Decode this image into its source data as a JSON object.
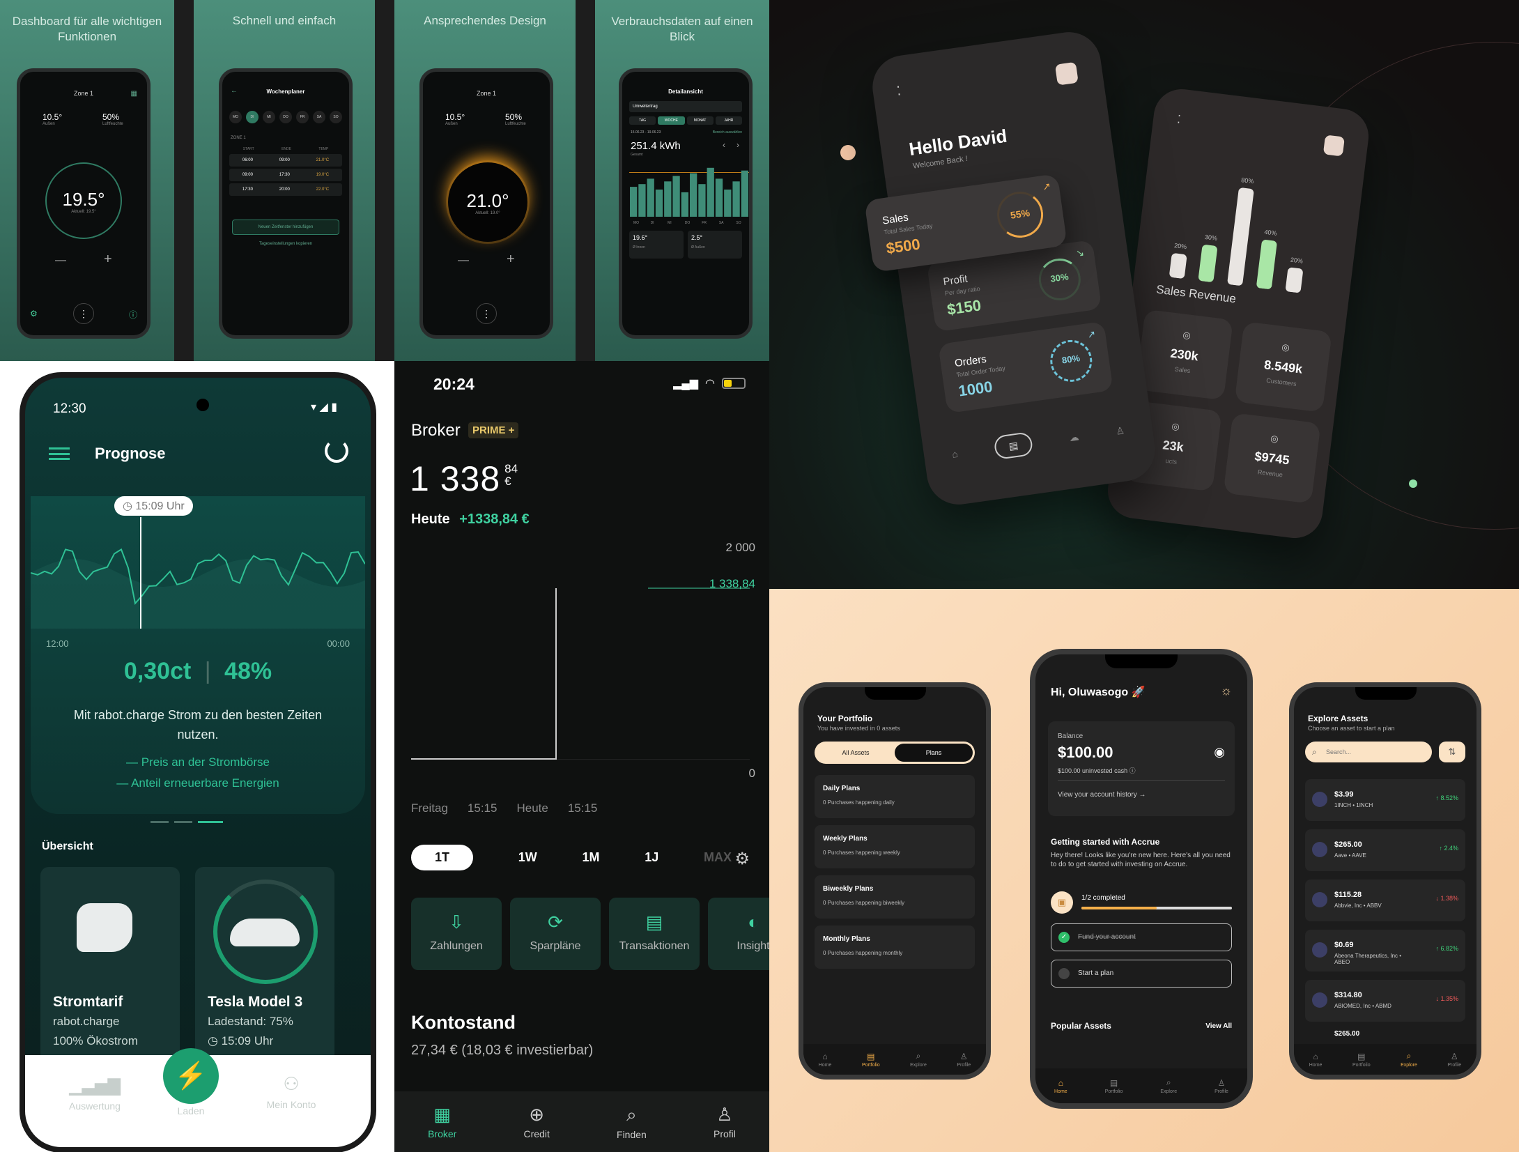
{
  "promo": {
    "captions": [
      "Dashboard für alle wichtigen Funktionen",
      "Schnell und einfach",
      "Ansprechendes Design",
      "Verbrauchsdaten auf einen Blick"
    ],
    "p1": {
      "zone": "Zone 1",
      "val1": "10.5°",
      "lab1": "Außen",
      "val2": "50%",
      "lab2": "Luftfeuchte",
      "big": "19.5°",
      "sub": "Aktuell: 19.5°",
      "minus": "—",
      "plus": "+"
    },
    "p2": {
      "title": "Wochenplaner",
      "days": [
        "MO",
        "DI",
        "MI",
        "DO",
        "FR",
        "SA",
        "SO"
      ],
      "zone": "ZONE 1",
      "cols": [
        "START",
        "ENDE",
        "TEMP"
      ],
      "rows": [
        [
          "06:00",
          "09:00",
          "21.0°C"
        ],
        [
          "09:00",
          "17:30",
          "19.0°C"
        ],
        [
          "17:30",
          "20:00",
          "22.0°C"
        ]
      ],
      "btn": "Neuen Zeitfenster hinzufügen",
      "link": "Tageseinstellungen kopieren"
    },
    "p3": {
      "zone": "Zone 1",
      "val1": "10.5°",
      "lab1": "Außen",
      "val2": "50%",
      "lab2": "Luftfeuchte",
      "big": "21.0°",
      "sub": "Aktuell: 19.0°"
    },
    "p4": {
      "title": "Detailansicht",
      "select": "Umweltertrag",
      "tabs": [
        "TAG",
        "WOCHE",
        "MONAT",
        "JAHR"
      ],
      "range": "15.06.23 - 19.06.23",
      "compare": "Bereich auswählen",
      "kwh": "251.4 kWh",
      "kwhsub": "Gesamt",
      "cards": [
        {
          "v": "19.6°",
          "l": "Ø Innen"
        },
        {
          "v": "2.5°",
          "l": "Ø Außen"
        }
      ],
      "bars": [
        0.55,
        0.6,
        0.7,
        0.5,
        0.65,
        0.75,
        0.45,
        0.8,
        0.6,
        0.9,
        0.7,
        0.5,
        0.65,
        0.85
      ],
      "xl": [
        "MO",
        "DI",
        "MI",
        "DO",
        "FR",
        "SA",
        "SO"
      ]
    }
  },
  "dash": {
    "greeting": "Hello David",
    "welcome": "Welcome Back !",
    "sales": {
      "title": "Sales",
      "sub": "Total Sales Today",
      "value": "$500",
      "pct": "55%"
    },
    "profit": {
      "title": "Profit",
      "sub": "Per day ratio",
      "value": "$150",
      "pct": "30%"
    },
    "orders": {
      "title": "Orders",
      "sub": "Total Order Today",
      "value": "1000",
      "pct": "80%"
    },
    "revenue_title": "Sales Revenue",
    "chart_data": {
      "type": "bar",
      "values": [
        20,
        30,
        80,
        40,
        20
      ],
      "labels": [
        "20%",
        "30%",
        "80%",
        "40%",
        "20%"
      ]
    },
    "stats": [
      {
        "v": "230k",
        "l": "Sales"
      },
      {
        "v": "8.549k",
        "l": "Customers"
      },
      {
        "v": "23k",
        "l": "ucts"
      },
      {
        "v": "$9745",
        "l": "Revenue"
      }
    ]
  },
  "prognose": {
    "time": "12:30",
    "title": "Prognose",
    "tooltip": "15:09 Uhr",
    "x_start": "12:00",
    "x_end": "00:00",
    "price": "0,30ct",
    "sep": "|",
    "pct": "48%",
    "desc": "Mit rabot.charge Strom zu den besten Zeiten nutzen.",
    "legend1": "Preis an der Strombörse",
    "legend2": "Anteil erneuerbare Energien",
    "overview": "Übersicht",
    "card1": {
      "title": "Stromtarif",
      "l1": "rabot.charge",
      "l2": "100% Ökostrom"
    },
    "card2": {
      "title": "Tesla Model 3",
      "l1": "Ladestand: 75%",
      "l2": "15:09 Uhr"
    },
    "nav": [
      "Auswertung",
      "Laden",
      "Mein Konto"
    ]
  },
  "broker": {
    "time": "20:24",
    "title": "Broker",
    "badge": "PRIME +",
    "amount": "1 338",
    "cents": "84",
    "currency": "€",
    "today_label": "Heute",
    "today_value": "+1338,84 €",
    "y_top": "2 000",
    "y_val": "1 338,84",
    "y_zero": "0",
    "x_labels": [
      "Freitag",
      "15:15",
      "Heute",
      "15:15"
    ],
    "ranges": [
      "1T",
      "1W",
      "1M",
      "1J",
      "MAX"
    ],
    "actions": [
      "Zahlungen",
      "Sparpläne",
      "Transaktionen",
      "Insight"
    ],
    "kontostand": "Kontostand",
    "kontostand_value": "27,34 € (18,03 € investierbar)",
    "nav": [
      "Broker",
      "Credit",
      "Finden",
      "Profil"
    ]
  },
  "accrue": {
    "left": {
      "title": "Your Portfolio",
      "sub": "You have invested in 0 assets",
      "seg": [
        "All Assets",
        "Plans"
      ],
      "plans": [
        {
          "t": "Daily Plans",
          "s": "0 Purchases happening daily"
        },
        {
          "t": "Weekly Plans",
          "s": "0 Purchases happening weekly"
        },
        {
          "t": "Biweekly Plans",
          "s": "0 Purchases happening biweekly"
        },
        {
          "t": "Monthly Plans",
          "s": "0 Purchases happening monthly"
        }
      ]
    },
    "mid": {
      "hello": "Hi, Oluwasogo 🚀",
      "balance_label": "Balance",
      "balance": "$100.00",
      "uninvested": "$100.00 uninvested cash",
      "history": "View your account history",
      "gs_title": "Getting started with Accrue",
      "gs_text": "Hey there! Looks like you're new here. Here's all you need to do to get started with investing on Accrue.",
      "progress": "1/2 completed",
      "progress_value": 0.5,
      "task1": "Fund your account",
      "task2": "Start a plan",
      "popular": "Popular Assets",
      "viewall": "View All"
    },
    "right": {
      "title": "Explore Assets",
      "sub": "Choose an asset to start a plan",
      "search": "Search...",
      "assets": [
        {
          "p": "$3.99",
          "n": "1INCH",
          "t": "1INCH",
          "c": "8.52%",
          "up": true
        },
        {
          "p": "$265.00",
          "n": "Aave",
          "t": "AAVE",
          "c": "2.4%",
          "up": true
        },
        {
          "p": "$115.28",
          "n": "Abbvie, Inc",
          "t": "ABBV",
          "c": "1.38%",
          "up": false
        },
        {
          "p": "$0.69",
          "n": "Abeona Therapeutics, Inc",
          "t": "ABEO",
          "c": "6.82%",
          "up": true
        },
        {
          "p": "$314.80",
          "n": "ABIOMED, Inc",
          "t": "ABMD",
          "c": "1.35%",
          "up": false
        }
      ],
      "partial": "$265.00"
    },
    "nav": [
      "Home",
      "Portfolio",
      "Explore",
      "Profile"
    ]
  }
}
